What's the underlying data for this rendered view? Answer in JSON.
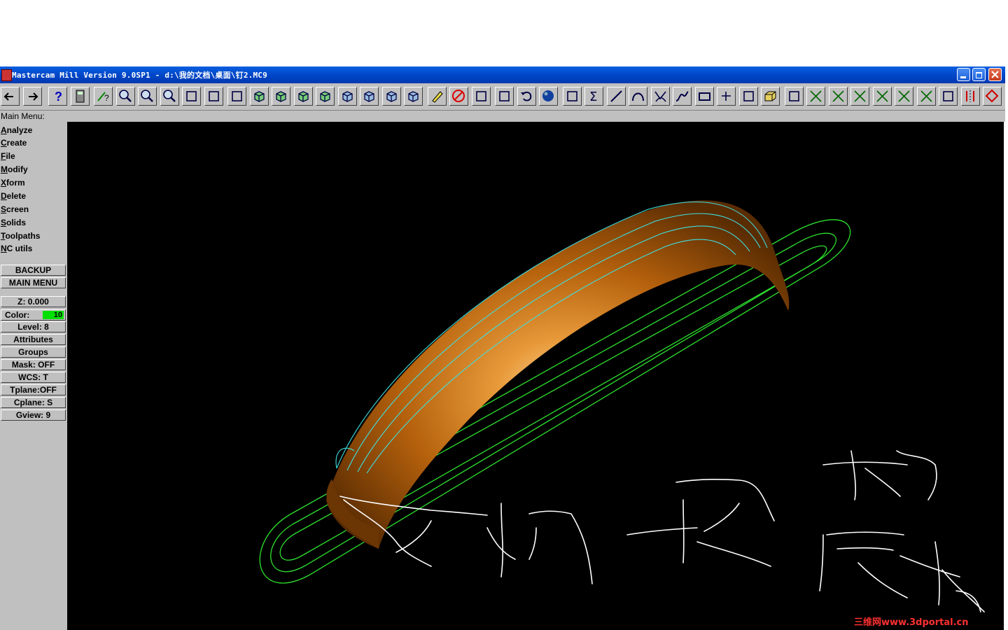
{
  "window": {
    "title": "Mastercam Mill Version 9.0SP1 - d:\\我的文档\\桌面\\钉2.MC9"
  },
  "toolbar": {
    "buttons": [
      "back-arrow-icon",
      "forward-arrow-icon",
      "help-icon",
      "calculator-icon",
      "analyze-icon",
      "zoom-icon",
      "zoom-out-icon",
      "zoom-window-icon",
      "pan-icon",
      "select-icon",
      "rotate-icon",
      "view-top-icon",
      "view-front-icon",
      "view-side-icon",
      "view-iso-icon",
      "view-cube-1-icon",
      "view-cube-2-icon",
      "view-cube-3-icon",
      "view-cube-4-icon",
      "erase-icon",
      "delete-icon",
      "group-icon",
      "result-icon",
      "undo-icon",
      "sphere-icon",
      "solid-icon",
      "sum-icon",
      "line-icon",
      "arc-icon",
      "fillet-icon",
      "spline-icon",
      "rectangle-icon",
      "point-icon",
      "surface-icon",
      "box-icon",
      "chain-icon",
      "trim-1-icon",
      "trim-2-icon",
      "trim-3-icon",
      "trim-4-icon",
      "extend-icon",
      "break-icon",
      "drill-icon",
      "mirror-icon",
      "shape-icon"
    ]
  },
  "menu": {
    "label": "Main Menu:",
    "items": [
      {
        "key": "A",
        "rest": "nalyze"
      },
      {
        "key": "C",
        "rest": "reate"
      },
      {
        "key": "F",
        "rest": "ile"
      },
      {
        "key": "M",
        "rest": "odify"
      },
      {
        "key": "X",
        "rest": "form"
      },
      {
        "key": "D",
        "rest": "elete"
      },
      {
        "key": "S",
        "rest": "creen"
      },
      {
        "key": "S",
        "rest": "olids"
      },
      {
        "key": "T",
        "rest": "oolpaths"
      },
      {
        "key": "N",
        "rest": "C utils"
      }
    ],
    "backup": "BACKUP",
    "main_menu": "MAIN MENU"
  },
  "status": {
    "z": "Z:  0.000",
    "color_label": "Color:",
    "color_value": "10",
    "level": "Level:  8",
    "attributes": "Attributes",
    "groups": "Groups",
    "mask": "Mask:  OFF",
    "wcs": "WCS:   T",
    "tplane": "Tplane:OFF",
    "cplane": "Cplane:  S",
    "gview": "Gview:   9"
  },
  "watermark": "三维网www.3dportal.cn",
  "colors": {
    "title_blue": "#0047c8",
    "chrome": "#c0c0c0",
    "viewport": "#000000",
    "toolpath_green": "#2ee02e",
    "toolpath_cyan": "#3fe0e0",
    "surface_orange": "#c8700a",
    "color_swatch": "#00e000"
  }
}
